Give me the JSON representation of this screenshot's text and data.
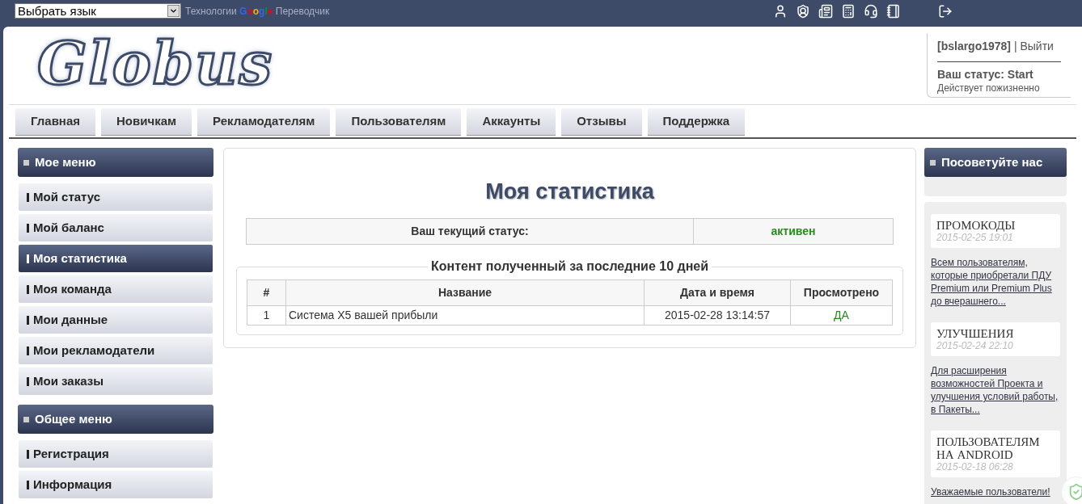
{
  "top_bar": {
    "language_select": {
      "value": "Выбрать язык"
    },
    "translate_credit": {
      "prefix": "Технологии",
      "brand": "Google",
      "suffix": "Переводчик"
    }
  },
  "logo": "Globus",
  "user_box": {
    "username": "[bslargo1978]",
    "separator": "|",
    "logout": "Выйти",
    "status": "Ваш статус: Start",
    "validity": "Действует пожизненно"
  },
  "nav": [
    "Главная",
    "Новичкам",
    "Рекламодателям",
    "Пользователям",
    "Аккаунты",
    "Отзывы",
    "Поддержка"
  ],
  "sidebar": [
    {
      "title": "Мое меню",
      "items": [
        {
          "label": "Мой статус",
          "selected": false
        },
        {
          "label": "Мой баланс",
          "selected": false
        },
        {
          "label": "Моя статистика",
          "selected": true
        },
        {
          "label": "Моя команда",
          "selected": false
        },
        {
          "label": "Мои данные",
          "selected": false
        },
        {
          "label": "Мои рекламодатели",
          "selected": false
        },
        {
          "label": "Мои заказы",
          "selected": false
        }
      ]
    },
    {
      "title": "Общее меню",
      "items": [
        {
          "label": "Регистрация",
          "selected": false
        },
        {
          "label": "Информация",
          "selected": false
        }
      ]
    }
  ],
  "main": {
    "title": "Моя статистика",
    "status_table": {
      "label": "Ваш текущий статус:",
      "value": "активен"
    },
    "content": {
      "legend": "Контент полученный за последние 10 дней",
      "columns": [
        "#",
        "Название",
        "Дата и время",
        "Просмотрено"
      ],
      "rows": [
        [
          "1",
          "Система X5 вашей прибыли",
          "2015-02-28 13:14:57",
          "ДА"
        ]
      ]
    }
  },
  "right": {
    "recommend_title": "Посоветуйте нас",
    "news": [
      {
        "title": "ПРОМОКОДЫ",
        "date": "2015-02-25 19:01",
        "excerpt": "Всем пользователям, которые приобретали ПДУ Premium или Premium Plus до вчерашнего..."
      },
      {
        "title": "УЛУЧШЕНИЯ",
        "date": "2015-02-24 22:10",
        "excerpt": "Для расширения возможностей Проекта и улучшения условий работы, в Пакеты..."
      },
      {
        "title": "ПОЛЬЗОВАТЕЛЯМ НА ANDROID",
        "date": "2015-02-18 06:28",
        "excerpt": "Уважаемые пользователи!"
      }
    ]
  }
}
